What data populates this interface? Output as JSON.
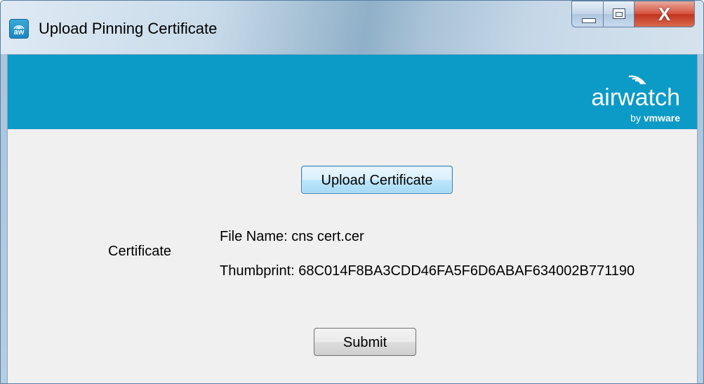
{
  "window": {
    "title": "Upload Pinning Certificate",
    "app_icon_text": "aw",
    "close_glyph": "X"
  },
  "banner": {
    "brand_name": "airwatch",
    "brand_by": "by ",
    "brand_company": "vmware",
    "color": "#0c9ac7"
  },
  "form": {
    "upload_button_label": "Upload Certificate",
    "certificate_label": "Certificate",
    "file_name": "File Name: cns cert.cer",
    "thumbprint": "Thumbprint: 68C014F8BA3CDD46FA5F6D6ABAF634002B771190",
    "submit_button_label": "Submit"
  }
}
